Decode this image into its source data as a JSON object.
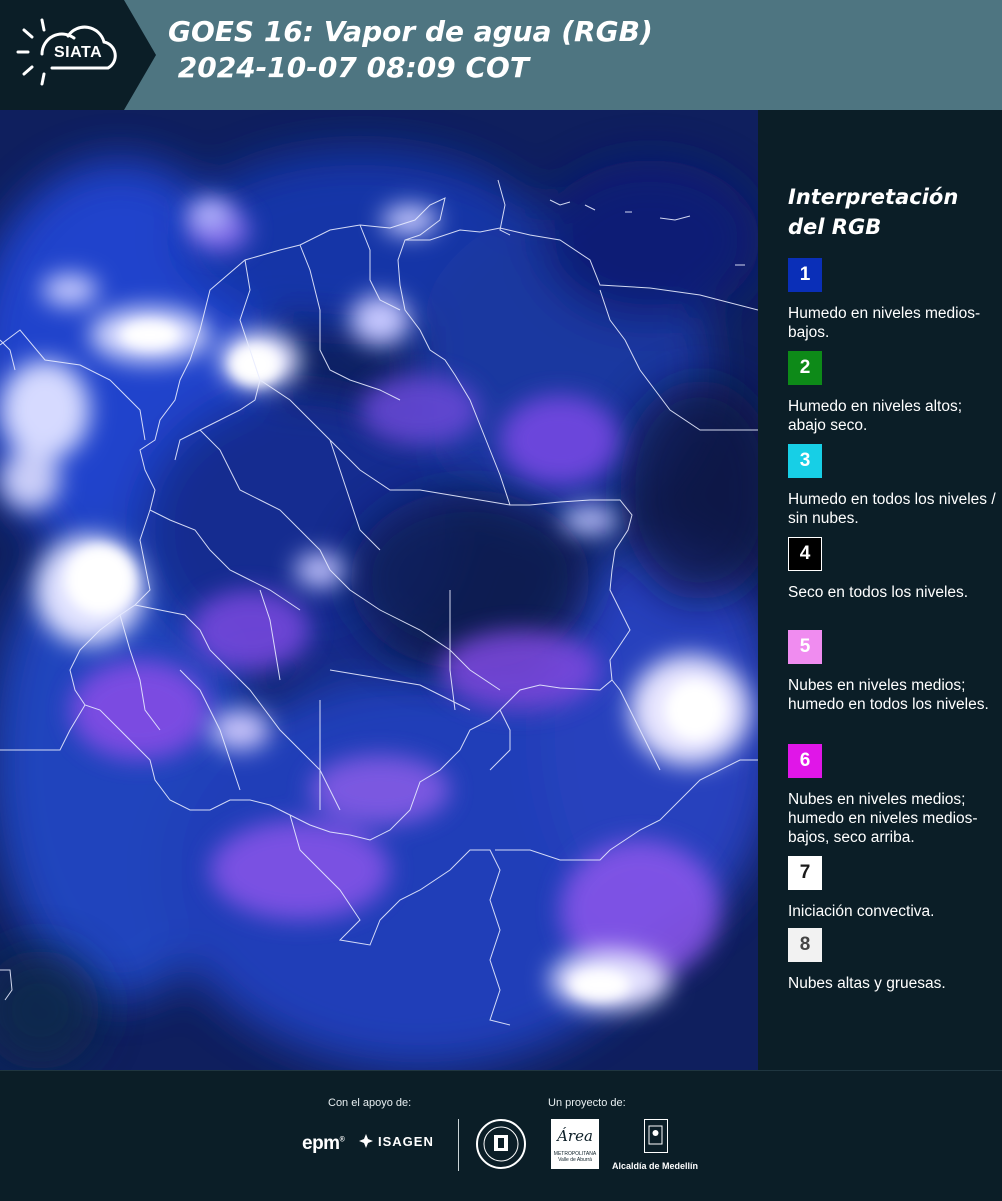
{
  "header": {
    "logo_text": "SIATA",
    "title_line1": "GOES 16: Vapor de agua (RGB)",
    "title_line2": " 2024-10-07 08:09 COT"
  },
  "legend": {
    "title": "Interpretación\ndel RGB",
    "items": [
      {
        "number": "1",
        "color": "#0a2fb8",
        "text_color": "#ffffff",
        "description": "Humedo en niveles medios-bajos."
      },
      {
        "number": "2",
        "color": "#0d8a18",
        "text_color": "#ffffff",
        "description": "Humedo en niveles altos; abajo seco."
      },
      {
        "number": "3",
        "color": "#17cfe6",
        "text_color": "#ffffff",
        "description": "Humedo en todos los niveles / sin nubes."
      },
      {
        "number": "4",
        "color": "#000000",
        "text_color": "#ffffff",
        "description": "Seco en todos los niveles."
      },
      {
        "number": "5",
        "color": "#f08cf0",
        "text_color": "#ffffff",
        "description": "Nubes en niveles medios; humedo en todos los niveles."
      },
      {
        "number": "6",
        "color": "#e016e8",
        "text_color": "#ffffff",
        "description": "Nubes en niveles medios; humedo en niveles medios-bajos, seco arriba."
      },
      {
        "number": "7",
        "color": "#ffffff",
        "text_color": "#1b1b1b",
        "description": "Iniciación convectiva."
      },
      {
        "number": "8",
        "color": "#f2f2f2",
        "text_color": "#444444",
        "description": "Nubes altas y gruesas."
      }
    ]
  },
  "footer": {
    "support_label": "Con el apoyo de:",
    "project_label": "Un proyecto de:",
    "sponsor_epm": "epm",
    "sponsor_isagen": "ISAGEN",
    "area_logo_text": "Área",
    "area_logo_subtext": "METROPOLITANA Valle de Aburrá",
    "alcaldia_text": "Alcaldía de Medellín"
  },
  "colors": {
    "header_bg": "#4e7581",
    "panel_bg": "#0b1e27",
    "map_base": "#0d1d55"
  }
}
